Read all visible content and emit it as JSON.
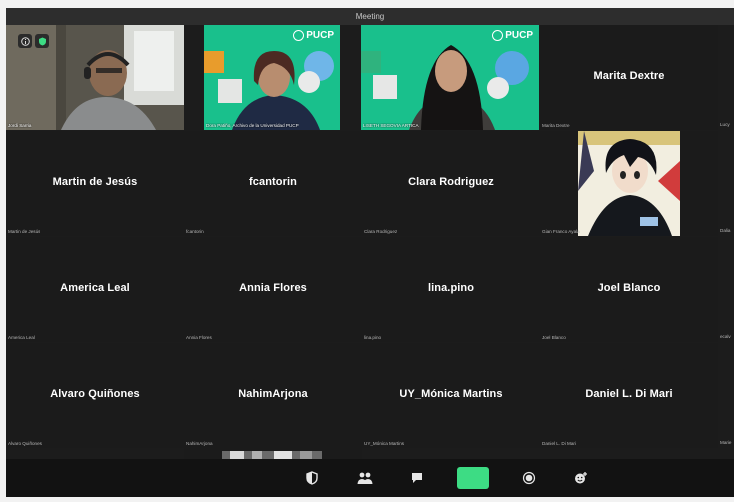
{
  "window": {
    "title": "Meeting"
  },
  "colors": {
    "accent_green": "#3ddc84",
    "pucp_green": "#19c08c",
    "tile_bg": "#1b1b1b"
  },
  "tiles": [
    {
      "id": "t1",
      "label": "Jordi Sarria",
      "kind": "video-man"
    },
    {
      "id": "t2",
      "label": "Dora Patiño, Archivo de la Universidad PUCP",
      "kind": "video-woman-older"
    },
    {
      "id": "t3",
      "label": "LISETH SEGOVIA ARTICA",
      "kind": "video-woman-young"
    },
    {
      "id": "t4",
      "name": "Marita Dextre",
      "label": "Marita Dextre"
    },
    {
      "id": "t5",
      "name": "Martin de Jesús",
      "label": "Martin de Jesús"
    },
    {
      "id": "t6",
      "name": "fcantorin",
      "label": "fcantorin"
    },
    {
      "id": "t7",
      "name": "Clara Rodriguez",
      "label": "Clara Rodriguez"
    },
    {
      "id": "t8",
      "label": "Gian Franco Ayala",
      "kind": "avatar-anime"
    },
    {
      "id": "t9",
      "name": "America Leal",
      "label": "America Leal"
    },
    {
      "id": "t10",
      "name": "Annia Flores",
      "label": "Annia Flores"
    },
    {
      "id": "t11",
      "name": "lina.pino",
      "label": "lina.pino"
    },
    {
      "id": "t12",
      "name": "Joel Blanco",
      "label": "Joel Blanco"
    },
    {
      "id": "t13",
      "name": "Alvaro Quiñones",
      "label": "Alvaro Quiñones"
    },
    {
      "id": "t14",
      "name": "NahimArjona",
      "label": "NahimArjona"
    },
    {
      "id": "t15",
      "name": "UY_Mónica Martins",
      "label": "UY_Mónica Martins"
    },
    {
      "id": "t16",
      "name": "Daniel L. Di Mari",
      "label": "Daniel L. Di Mari"
    }
  ],
  "pucp_brand": "PUCP",
  "edge_labels": [
    "Lucy",
    "Dalia",
    "ecalv",
    "Marie"
  ],
  "toolbar_icons": [
    "shield-icon",
    "participants-icon",
    "chat-icon",
    "share-screen-icon",
    "record-icon",
    "reactions-icon"
  ]
}
